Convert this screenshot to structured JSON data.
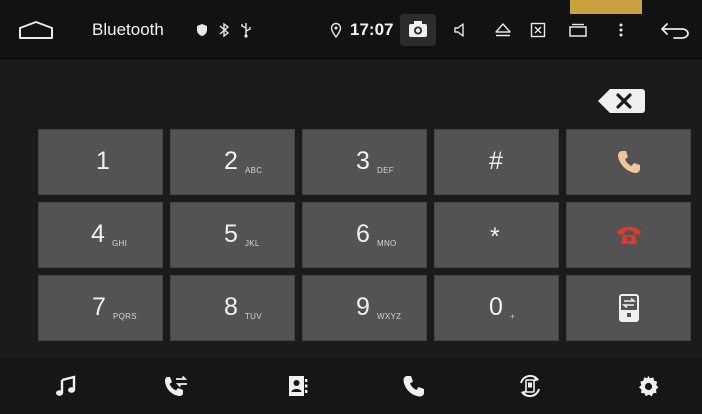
{
  "statusbar": {
    "title": "Bluetooth",
    "time": "17:07"
  },
  "keypad": {
    "keys": [
      {
        "digit": "1",
        "letters": ""
      },
      {
        "digit": "2",
        "letters": "ABC"
      },
      {
        "digit": "3",
        "letters": "DEF"
      },
      {
        "digit": "#",
        "letters": ""
      },
      {
        "digit": "4",
        "letters": "GHI"
      },
      {
        "digit": "5",
        "letters": "JKL"
      },
      {
        "digit": "6",
        "letters": "MNO"
      },
      {
        "digit": "*",
        "letters": ""
      },
      {
        "digit": "7",
        "letters": "PQRS"
      },
      {
        "digit": "8",
        "letters": "TUV"
      },
      {
        "digit": "9",
        "letters": "WXYZ"
      },
      {
        "digit": "0",
        "letters": "+"
      }
    ]
  },
  "colors": {
    "call_green": "#f0c69a",
    "hangup_red": "#e03a2c",
    "key_bg": "#535353",
    "background": "#1b1b1b"
  },
  "icons": {
    "statusbar": [
      "home-icon",
      "shield-icon",
      "bluetooth-icon",
      "usb-icon",
      "location-icon",
      "camera-icon",
      "volume-icon",
      "eject-icon",
      "close-window-icon",
      "recent-apps-icon",
      "more-menu-icon",
      "back-icon"
    ],
    "bottombar": [
      "music-icon",
      "call-log-icon",
      "contacts-icon",
      "dialer-icon",
      "sync-icon",
      "settings-icon"
    ]
  }
}
